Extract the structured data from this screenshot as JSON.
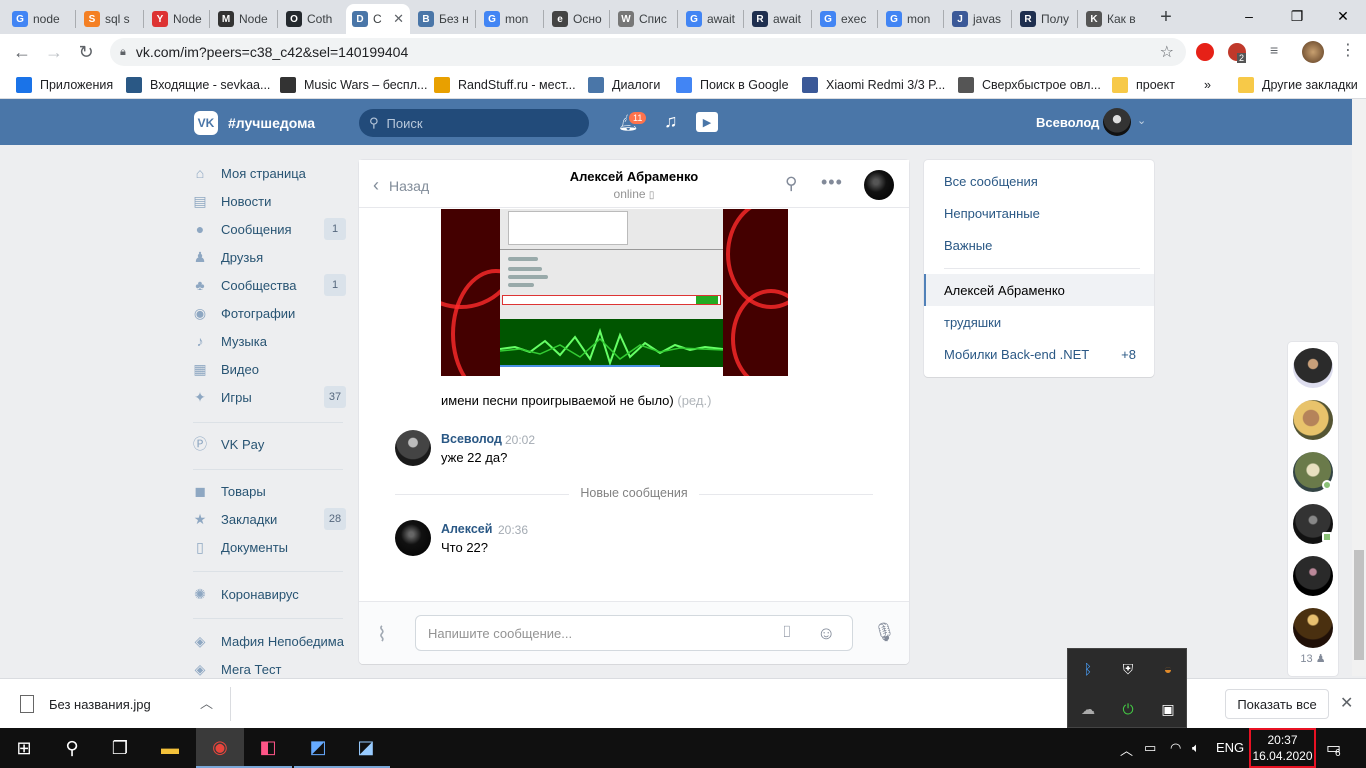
{
  "browser": {
    "tabs": [
      {
        "label": "node",
        "icon": "G",
        "color": "#4285f4"
      },
      {
        "label": "sql s",
        "icon": "S",
        "color": "#f48024"
      },
      {
        "label": "Node",
        "icon": "Y",
        "color": "#d33"
      },
      {
        "label": "Node",
        "icon": "M",
        "color": "#333"
      },
      {
        "label": "Coth",
        "icon": "O",
        "color": "#24292e"
      },
      {
        "label": "С",
        "icon": "D",
        "color": "#4a76a8",
        "active": true
      },
      {
        "label": "Без н",
        "icon": "B",
        "color": "#4a76a8"
      },
      {
        "label": "mon",
        "icon": "G",
        "color": "#4285f4"
      },
      {
        "label": "Осно",
        "icon": "e",
        "color": "#444"
      },
      {
        "label": "Спис",
        "icon": "W",
        "color": "#777"
      },
      {
        "label": "await",
        "icon": "G",
        "color": "#4285f4"
      },
      {
        "label": "await",
        "icon": "R",
        "color": "#1f2f4f"
      },
      {
        "label": "exec",
        "icon": "G",
        "color": "#4285f4"
      },
      {
        "label": "mon",
        "icon": "G",
        "color": "#4285f4"
      },
      {
        "label": "javas",
        "icon": "J",
        "color": "#3b5998"
      },
      {
        "label": "Полу",
        "icon": "R",
        "color": "#1f2f4f"
      },
      {
        "label": "Как в",
        "icon": "K",
        "color": "#555"
      }
    ],
    "tab_close": "✕",
    "new_tab": "+",
    "window_buttons": {
      "minimize": "–",
      "maximize": "❐",
      "close": "✕"
    },
    "url": "vk.com/im?peers=c38_c42&sel=140199404",
    "bookmarks": [
      {
        "label": "Приложения",
        "icon": "apps-icon",
        "color": "#1a73e8"
      },
      {
        "label": "Входящие - sevkaa...",
        "icon": "mail-icon",
        "color": "#2a5885"
      },
      {
        "label": "Music Wars – беспл...",
        "icon": "music-wars-icon",
        "color": "#333"
      },
      {
        "label": "RandStuff.ru - мест...",
        "icon": "randstuff-icon",
        "color": "#e8a000"
      },
      {
        "label": "Диалоги",
        "icon": "dialogs-icon",
        "color": "#4a76a8"
      },
      {
        "label": "Поиск в Google",
        "icon": "google-icon",
        "color": "#4285f4"
      },
      {
        "label": "Xiaomi Redmi 3/3 P...",
        "icon": "xiaomi-icon",
        "color": "#3b5998"
      },
      {
        "label": "Сверхбыстрое овл...",
        "icon": "globe-icon",
        "color": "#555"
      },
      {
        "label": "проект",
        "icon": "folder-icon",
        "color": "#f7c948"
      }
    ],
    "bookmarks_more": "»",
    "other_bookmarks": "Другие закладки",
    "ext_badge": "2"
  },
  "vk": {
    "brand": "#лучшедома",
    "logo": "VK",
    "search_placeholder": "Поиск",
    "notifications_count": "11",
    "user_name": "Всеволод",
    "menu": [
      {
        "label": "Моя страница",
        "icon": "⌂",
        "count": ""
      },
      {
        "label": "Новости",
        "icon": "▤",
        "count": ""
      },
      {
        "label": "Сообщения",
        "icon": "●",
        "count": "1"
      },
      {
        "label": "Друзья",
        "icon": "♟",
        "count": ""
      },
      {
        "label": "Сообщества",
        "icon": "♣",
        "count": "1"
      },
      {
        "label": "Фотографии",
        "icon": "◉",
        "count": ""
      },
      {
        "label": "Музыка",
        "icon": "♪",
        "count": ""
      },
      {
        "label": "Видео",
        "icon": "▦",
        "count": ""
      },
      {
        "label": "Игры",
        "icon": "✦",
        "count": "37"
      },
      {
        "label": "VK Pay",
        "icon": "Ⓟ",
        "count": ""
      },
      {
        "label": "Товары",
        "icon": "◼",
        "count": ""
      },
      {
        "label": "Закладки",
        "icon": "★",
        "count": "28"
      },
      {
        "label": "Документы",
        "icon": "▯",
        "count": ""
      },
      {
        "label": "Коронавирус",
        "icon": "✺",
        "count": ""
      },
      {
        "label": "Мафия Непобедима",
        "icon": "◈",
        "count": ""
      },
      {
        "label": "Мега Тест",
        "icon": "◈",
        "count": ""
      }
    ]
  },
  "chat": {
    "back_label": "Назад",
    "title": "Алексей Абраменко",
    "status": "online",
    "messages": [
      {
        "text": "имени песни проигрываемой не было)",
        "edited": "(ред.)"
      },
      {
        "author": "Всеволод",
        "time": "20:02",
        "text": "уже 22 да?"
      },
      {
        "author": "Алексей",
        "time": "20:36",
        "text": "Что 22?"
      }
    ],
    "new_messages_label": "Новые сообщения",
    "input_placeholder": "Напишите сообщение..."
  },
  "filters": {
    "items": [
      "Все сообщения",
      "Непрочитанные",
      "Важные"
    ],
    "chats": [
      {
        "label": "Алексей Абраменко",
        "selected": true,
        "count": ""
      },
      {
        "label": "трудяшки",
        "selected": false,
        "count": ""
      },
      {
        "label": "Мобилки Back-end .NET",
        "selected": false,
        "count": "+8"
      }
    ]
  },
  "side_chats_count": "13",
  "download": {
    "file": "Без названия.jpg",
    "show_all": "Показать все"
  },
  "taskbar": {
    "lang": "ENG",
    "time": "20:37",
    "date": "16.04.2020",
    "notifications": "6"
  }
}
